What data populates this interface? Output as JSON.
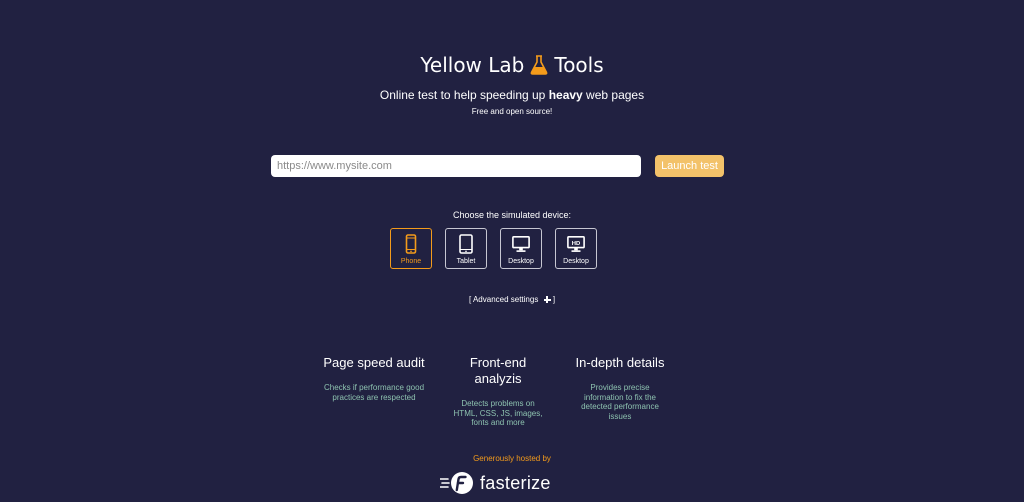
{
  "header": {
    "title_before": "Yellow Lab",
    "title_after": "Tools",
    "flask_icon": "flask-icon",
    "subtitle_before": "Online test to help speeding up ",
    "subtitle_bold": "heavy",
    "subtitle_after": " web pages",
    "tagline": "Free and open source!"
  },
  "form": {
    "url_placeholder": "https://www.mysite.com",
    "launch_label": "Launch test"
  },
  "devices": {
    "label": "Choose the simulated device:",
    "items": [
      {
        "label": "Phone",
        "icon": "phone-icon",
        "selected": true
      },
      {
        "label": "Tablet",
        "icon": "tablet-icon",
        "selected": false
      },
      {
        "label": "Desktop",
        "icon": "desktop-icon",
        "selected": false
      },
      {
        "label": "Desktop",
        "icon": "desktop-hd-icon",
        "selected": false,
        "badge": "HD"
      }
    ]
  },
  "advanced": {
    "label": "[ Advanced settings",
    "close": "]"
  },
  "features": [
    {
      "title": "Page speed audit",
      "desc": "Checks if performance good practices are respected"
    },
    {
      "title": "Front-end analyzis",
      "desc": "Detects problems on HTML, CSS, JS, images, fonts and more"
    },
    {
      "title": "In-depth details",
      "desc": "Provides precise information to fix the detected performance issues"
    }
  ],
  "footer": {
    "hosted_by": "Generously hosted by",
    "sponsor": "fasterize"
  },
  "colors": {
    "background": "#212141",
    "accent": "#f49b1b",
    "button": "#f3c26a",
    "feature_text": "#8ec3b0"
  }
}
